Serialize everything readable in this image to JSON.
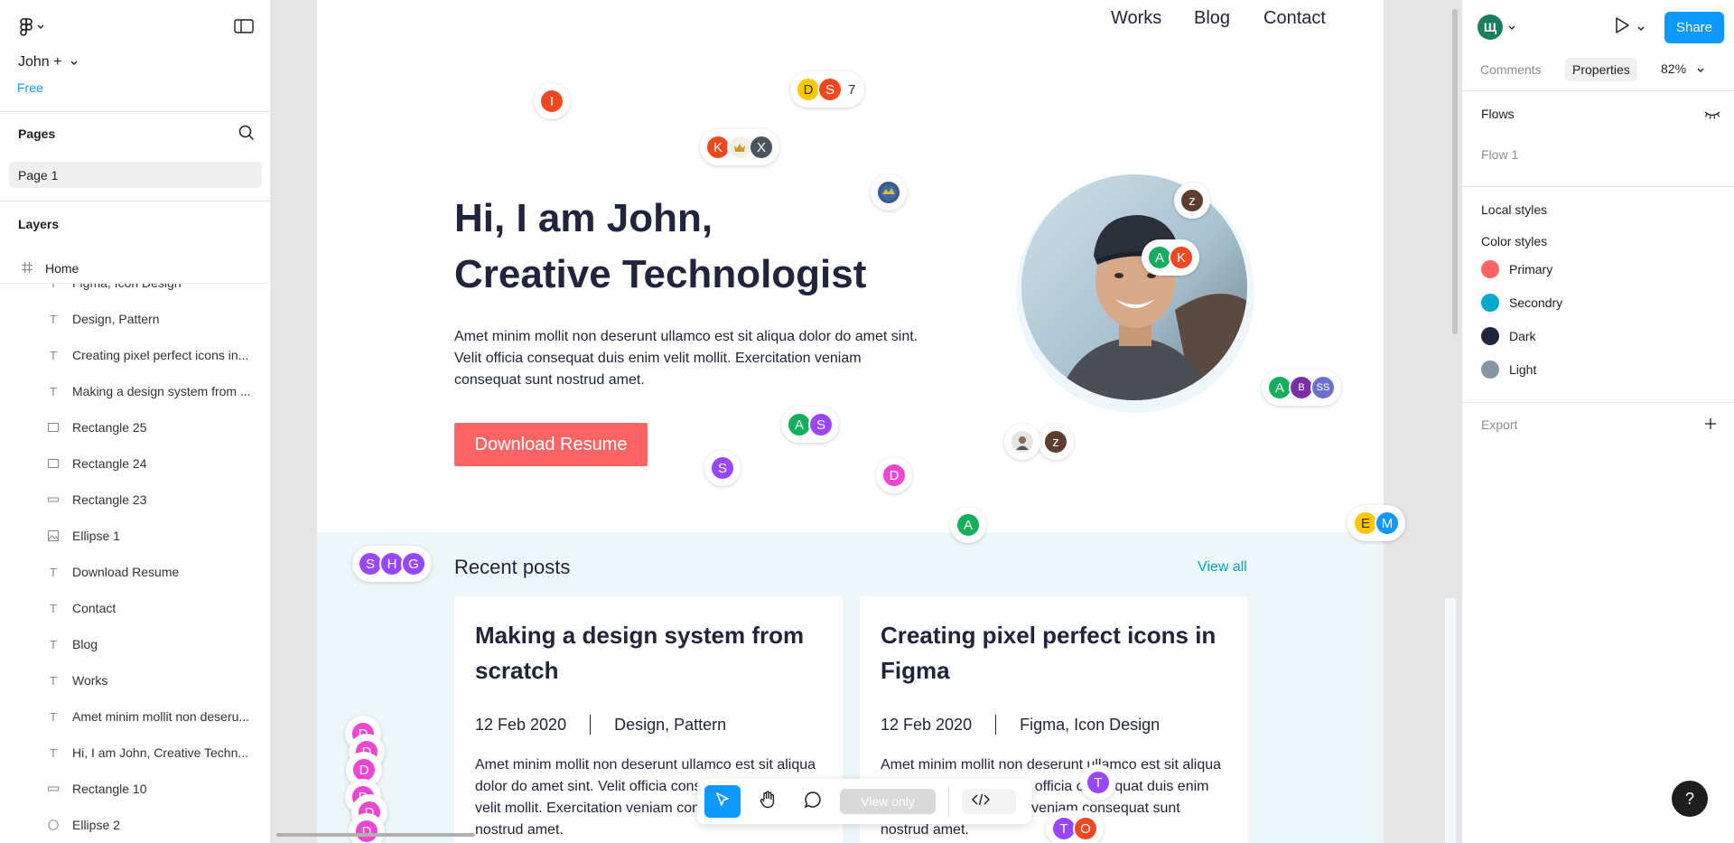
{
  "file": {
    "name": "John +",
    "plan": "Free"
  },
  "pages": {
    "header": "Pages",
    "items": [
      {
        "label": "Page 1"
      }
    ]
  },
  "layers": {
    "header": "Layers",
    "root": "Home",
    "items": [
      {
        "label": "Figma, Icon Design",
        "icon": "text-icon"
      },
      {
        "label": "Design, Pattern",
        "icon": "text-icon"
      },
      {
        "label": "Creating pixel perfect icons in...",
        "icon": "text-icon"
      },
      {
        "label": "Making a design system from ...",
        "icon": "text-icon"
      },
      {
        "label": "Rectangle 25",
        "icon": "rectangle-icon"
      },
      {
        "label": "Rectangle 24",
        "icon": "rectangle-icon"
      },
      {
        "label": "Rectangle 23",
        "icon": "line-icon"
      },
      {
        "label": "Ellipse 1",
        "icon": "image-icon"
      },
      {
        "label": "Download Resume",
        "icon": "text-icon"
      },
      {
        "label": "Contact",
        "icon": "text-icon"
      },
      {
        "label": "Blog",
        "icon": "text-icon"
      },
      {
        "label": "Works",
        "icon": "text-icon"
      },
      {
        "label": "Amet minim mollit non deseru...",
        "icon": "text-icon"
      },
      {
        "label": "Hi, I am John, Creative Techn...",
        "icon": "text-icon"
      },
      {
        "label": "Rectangle 10",
        "icon": "line-icon"
      },
      {
        "label": "Ellipse 2",
        "icon": "ellipse-icon"
      }
    ]
  },
  "site": {
    "nav": {
      "works": "Works",
      "blog": "Blog",
      "contact": "Contact"
    },
    "hero": {
      "title_line1": "Hi, I am John,",
      "title_line2": "Creative Technologist",
      "text": "Amet minim mollit non deserunt ullamco est sit aliqua dolor do amet sint. Velit officia consequat duis enim velit mollit. Exercitation veniam consequat sunt nostrud amet.",
      "button": "Download Resume"
    },
    "posts": {
      "title": "Recent posts",
      "view_all": "View all",
      "items": [
        {
          "title": "Making a design system from scratch",
          "date": "12 Feb 2020",
          "tags": "Design, Pattern",
          "body": "Amet minim mollit non deserunt ullamco est sit aliqua dolor do amet sint. Velit officia consequat duis enim velit mollit. Exercitation veniam consequat sunt nostrud amet."
        },
        {
          "title": "Creating pixel perfect icons in Figma",
          "date": "12 Feb 2020",
          "tags": "Figma, Icon Design",
          "body": "Amet minim mollit non deserunt ullamco est sit aliqua dolor do amet sint. Velit officia consequat duis enim velit mollit. Exercitation veniam consequat sunt nostrud amet."
        }
      ]
    }
  },
  "collaborators": {
    "i": "I",
    "d": "D",
    "s": "S",
    "count": "7",
    "k": "K",
    "x": "X",
    "z": "z",
    "a": "A",
    "b": "B",
    "ss": "SS",
    "h": "H",
    "g": "G",
    "e": "E",
    "m": "M",
    "t": "T",
    "o": "O"
  },
  "toolbar": {
    "view_only": "View only"
  },
  "right": {
    "user_initial": "Щ",
    "share": "Share",
    "tabs": {
      "comments": "Comments",
      "properties": "Properties"
    },
    "zoom": "82%",
    "flows": {
      "header": "Flows",
      "item": "Flow 1"
    },
    "local_styles": "Local styles",
    "color_styles": {
      "header": "Color styles",
      "items": [
        {
          "name": "Primary",
          "color": "#ff6464"
        },
        {
          "name": "Secondry",
          "color": "#00a8cc"
        },
        {
          "name": "Dark",
          "color": "#21243d"
        },
        {
          "name": "Light",
          "color": "#8695a4"
        }
      ]
    },
    "export": "Export",
    "help": "?"
  },
  "colors": {
    "accent": "#0d99ff",
    "primary": "#ff6464",
    "secondary": "#00a8cc",
    "dark": "#21243d"
  }
}
